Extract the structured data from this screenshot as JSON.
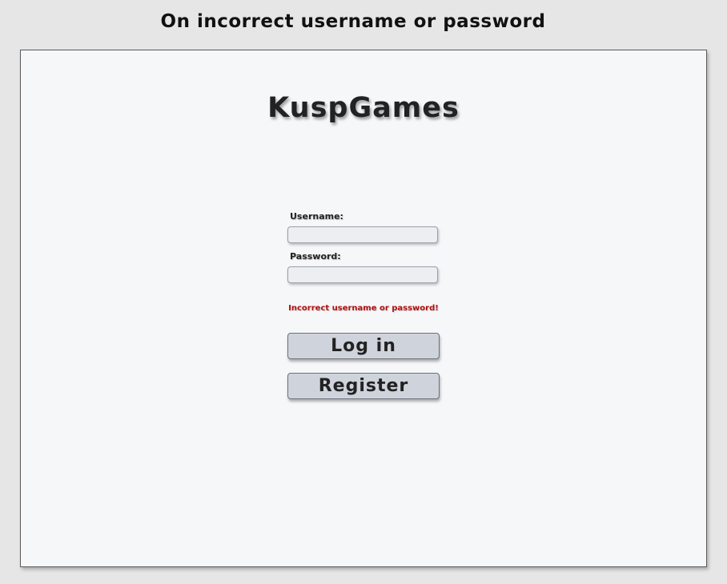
{
  "caption": "On incorrect username or password",
  "app": {
    "brand": "KuspGames"
  },
  "login_form": {
    "username_label": "Username:",
    "username_value": "",
    "password_label": "Password:",
    "password_value": "",
    "error_message": "Incorrect username or password!",
    "login_button": "Log in",
    "register_button": "Register"
  },
  "colors": {
    "background": "#e6e6e6",
    "frame_background": "#f6f7f9",
    "error_text": "#b01010",
    "button_fill": "#cfd4dc"
  }
}
